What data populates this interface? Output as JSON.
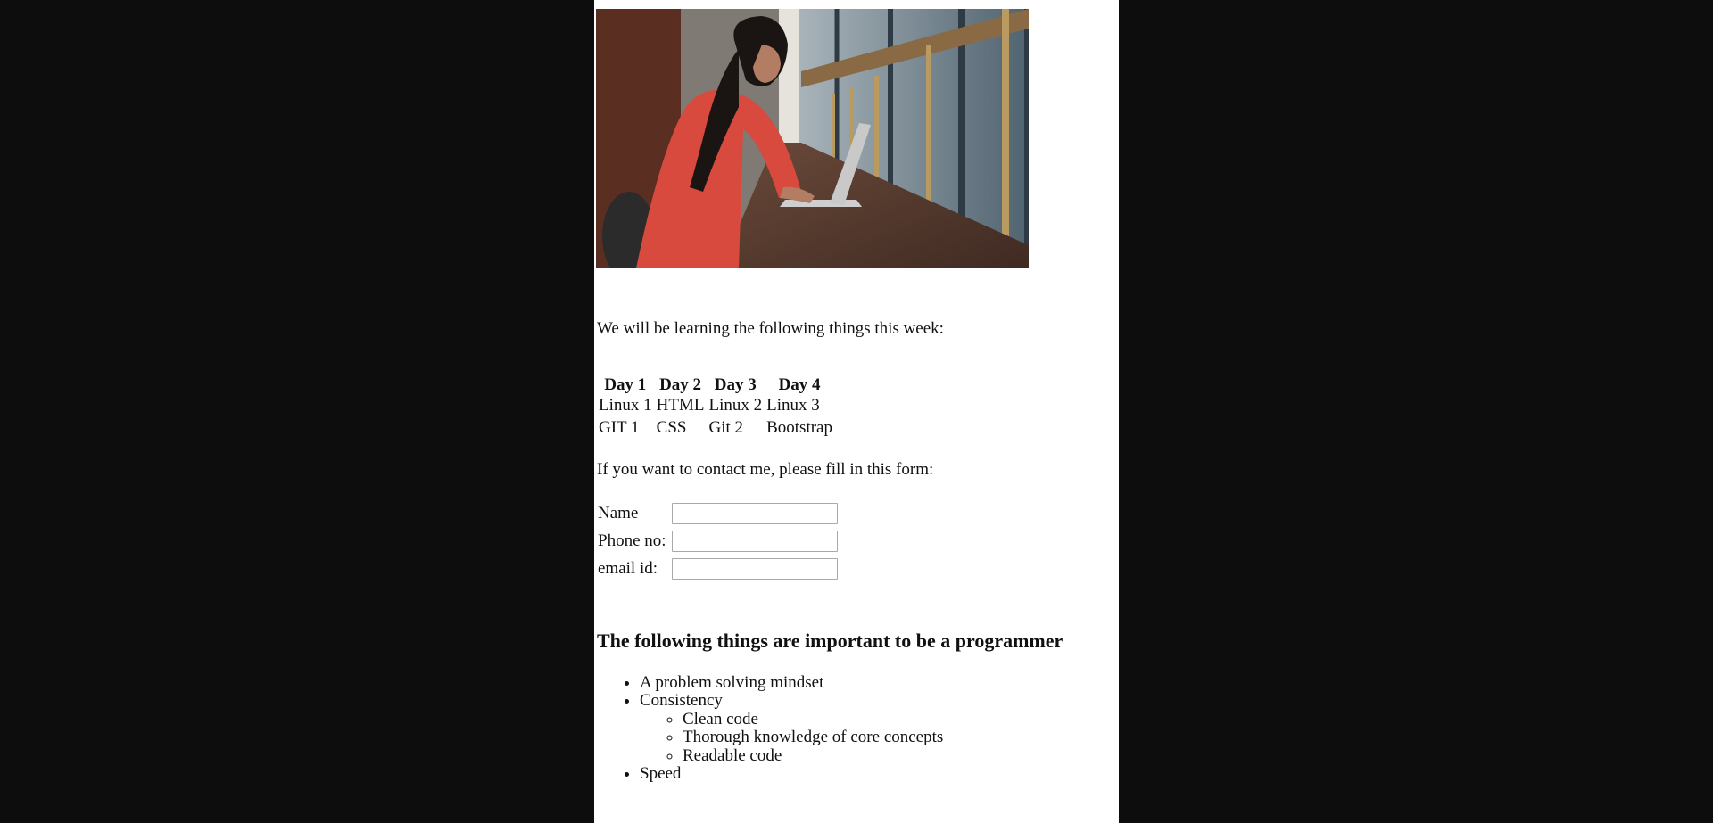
{
  "photo": {
    "subject": "woman in red sweater typing on laptop at a long wooden counter"
  },
  "intro": "We will be learning the following things this week:",
  "schedule": {
    "headers": [
      "Day 1",
      "Day 2",
      "Day 3",
      "Day 4"
    ],
    "rows": [
      [
        "Linux 1",
        "HTML",
        "Linux 2",
        "Linux 3"
      ],
      [
        "GIT 1",
        "CSS",
        "Git 2",
        "Bootstrap"
      ]
    ]
  },
  "contact": {
    "prompt": "If you want to contact me, please fill in this form:",
    "fields": [
      {
        "label": "Name",
        "value": ""
      },
      {
        "label": "Phone no:",
        "value": ""
      },
      {
        "label": "email id:",
        "value": ""
      }
    ]
  },
  "skills": {
    "heading": "The following things are important to be a programmer",
    "items": [
      "A problem solving mindset",
      "Consistency",
      "Speed"
    ],
    "consistency_subitems": [
      "Clean code",
      "Thorough knowledge of core concepts",
      "Readable code"
    ]
  }
}
